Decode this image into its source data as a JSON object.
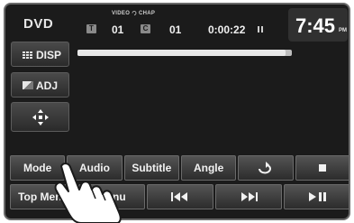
{
  "header": {
    "source": "DVD",
    "video_label": "VIDEO",
    "chap_label": "CHAP",
    "title_icon": "T",
    "title_number": "01",
    "chapter_icon": "C",
    "chapter_number": "01",
    "elapsed_time": "0:00:22",
    "play_state": "pause-icon",
    "clock": "7:45",
    "ampm": "PM"
  },
  "side_buttons": {
    "disp": "DISP",
    "adj": "ADJ",
    "move_icon": "four-way-arrow-icon"
  },
  "progress": {
    "fraction": 0.97
  },
  "row1": [
    "Mode",
    "Audio",
    "Subtitle",
    "Angle",
    "repeat-icon",
    "stop-icon"
  ],
  "row2": {
    "top_menu": "Top Menu",
    "menu": "Menu",
    "prev_icon": "previous-icon",
    "next_icon": "next-icon",
    "playpause_icon": "play-pause-icon"
  },
  "colors": {
    "screen_bg": "#1b1b1b",
    "button_grad_top": "#545454",
    "button_grad_bottom": "#2c2c2c",
    "text": "#f2f2f2"
  }
}
